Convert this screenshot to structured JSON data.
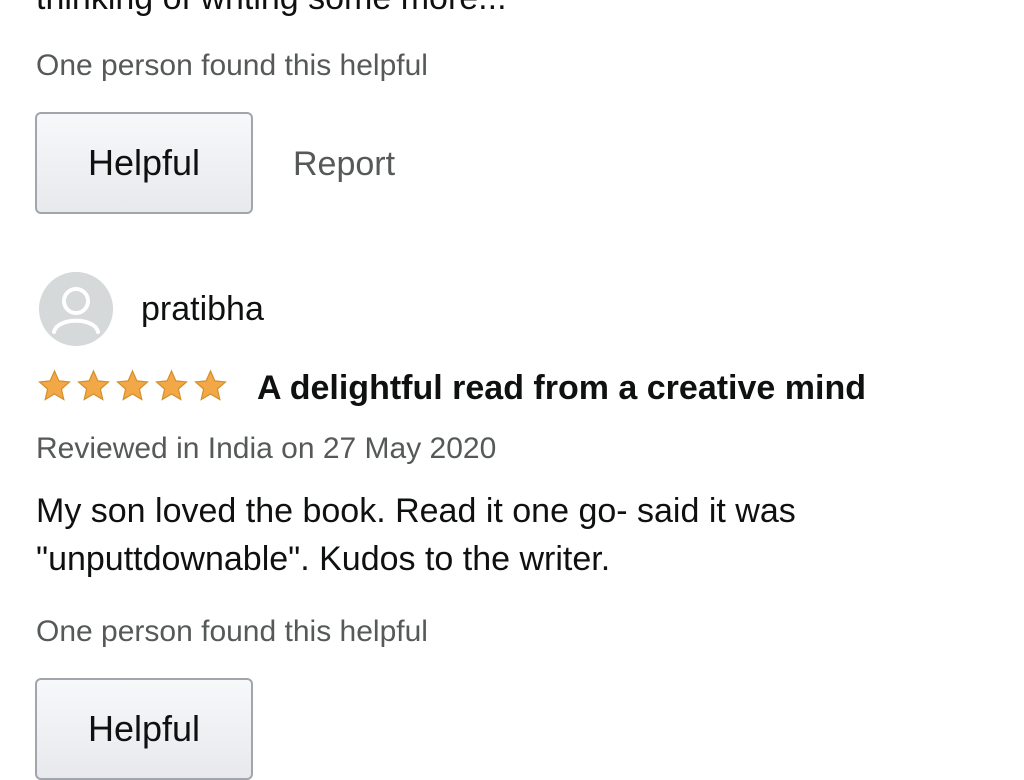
{
  "previous_review": {
    "body_tail": "thinking of writing some more...",
    "helpful_count": "One person found this helpful",
    "helpful_label": "Helpful",
    "report_label": "Report"
  },
  "review": {
    "reviewer": "pratibha",
    "rating": 5,
    "title": "A delightful read from a creative mind",
    "date": "Reviewed in India on 27 May 2020",
    "body_line1": "My son loved the book. Read it one go- said it was",
    "body_line2": "\"unputtdownable\". Kudos to the writer.",
    "helpful_count": "One person found this helpful",
    "helpful_label": "Helpful"
  },
  "colors": {
    "star": "#f3a847",
    "muted_text": "#565959"
  },
  "icons": {
    "avatar": "default-user-avatar-icon",
    "star": "star-filled-icon"
  }
}
